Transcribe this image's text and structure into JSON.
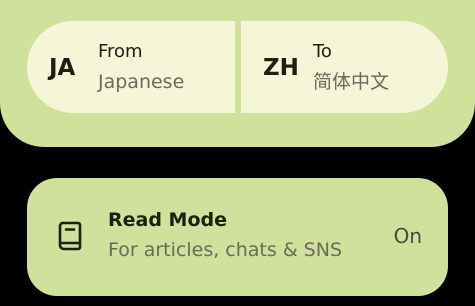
{
  "language_selector": {
    "source": {
      "code": "JA",
      "role": "From",
      "name": "Japanese"
    },
    "target": {
      "code": "ZH",
      "role": "To",
      "name": "简体中文"
    }
  },
  "read_mode": {
    "icon": "book-icon",
    "title": "Read Mode",
    "subtitle": "For articles, chats & SNS",
    "status": "On"
  },
  "colors": {
    "panel_background": "#cfe19a",
    "pill_background": "#f5f5d7",
    "page_background": "#000000",
    "primary_text": "#1d1f12",
    "secondary_text": "#6a6a5c"
  }
}
